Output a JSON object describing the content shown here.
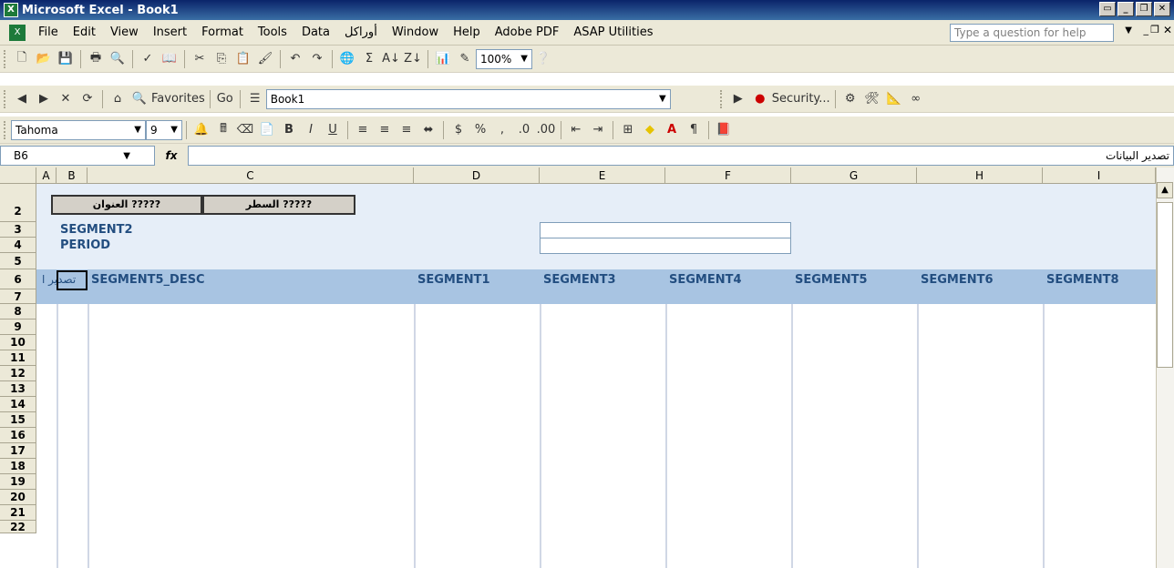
{
  "titlebar": {
    "title": "Microsoft Excel - Book1"
  },
  "menu": {
    "items": [
      "File",
      "Edit",
      "View",
      "Insert",
      "Format",
      "Tools",
      "Data",
      "أوراكل",
      "Window",
      "Help",
      "Adobe PDF",
      "ASAP Utilities"
    ],
    "question_placeholder": "Type a question for help"
  },
  "toolbar": {
    "zoom": "100%",
    "favorites": "Favorites",
    "go": "Go",
    "address": "Book1",
    "security": "Security...",
    "font": "Tahoma",
    "size": "9"
  },
  "formula": {
    "name_box": "B6",
    "fx": "fx",
    "value": "تصدير البيانات"
  },
  "columns": [
    "A",
    "B",
    "C",
    "D",
    "E",
    "F",
    "G",
    "H",
    "I"
  ],
  "rows": [
    "2",
    "3",
    "4",
    "5",
    "6",
    "7",
    "8",
    "9",
    "10",
    "11",
    "12",
    "13",
    "14",
    "15",
    "16",
    "17",
    "18",
    "19",
    "20",
    "21",
    "22"
  ],
  "sheet": {
    "btn_title": "العنوان ?????",
    "btn_row": "السطر ?????",
    "segment2": "SEGMENT2",
    "period": "PERIOD",
    "b6_text": "تصدير ا",
    "headers": [
      "SEGMENT5_DESC",
      "SEGMENT1",
      "SEGMENT3",
      "SEGMENT4",
      "SEGMENT5",
      "SEGMENT6",
      "SEGMENT8"
    ]
  }
}
